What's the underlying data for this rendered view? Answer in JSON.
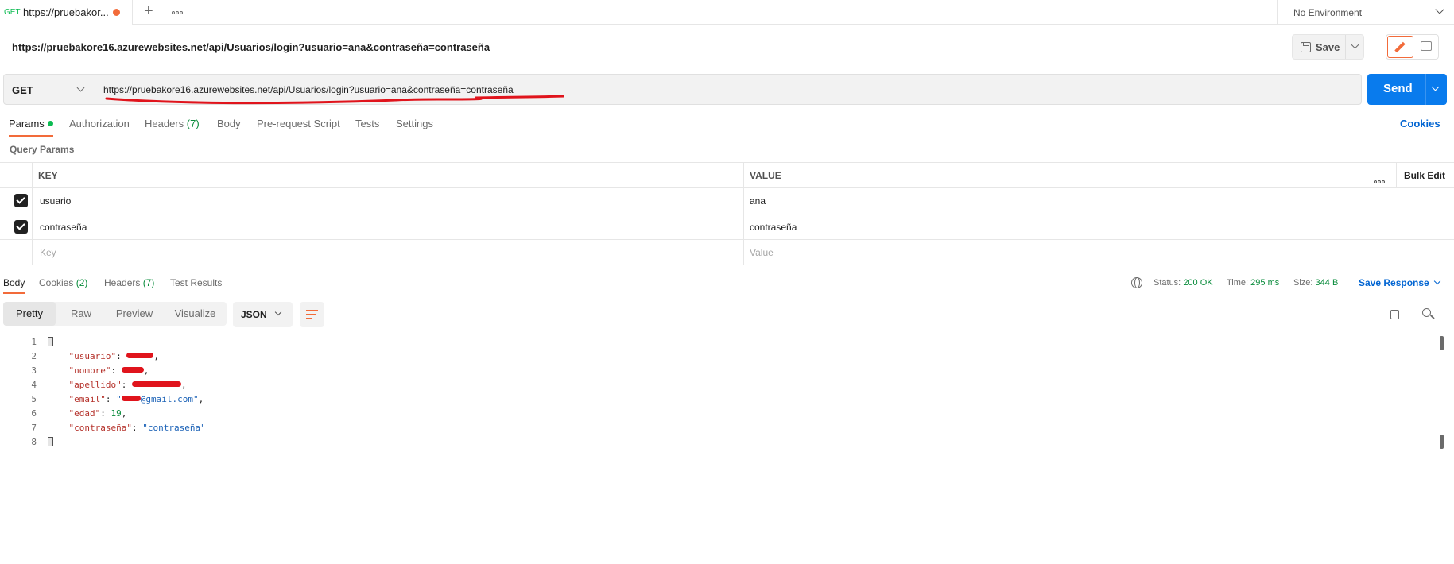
{
  "tabstrip": {
    "tab": {
      "method": "GET",
      "title": "https://pruebakor..."
    },
    "environment": "No Environment"
  },
  "request": {
    "name": "https://pruebakore16.azurewebsites.net/api/Usuarios/login?usuario=ana&contraseña=contraseña",
    "save_label": "Save",
    "method": "GET",
    "url": "https://pruebakore16.azurewebsites.net/api/Usuarios/login?usuario=ana&contraseña=contraseña",
    "send_label": "Send"
  },
  "request_tabs": {
    "params": "Params",
    "authorization": "Authorization",
    "headers": "Headers",
    "headers_count": "(7)",
    "body": "Body",
    "prerequest": "Pre-request Script",
    "tests": "Tests",
    "settings": "Settings",
    "cookies": "Cookies"
  },
  "query_params": {
    "title": "Query Params",
    "col_key": "KEY",
    "col_value": "VALUE",
    "bulk_edit": "Bulk Edit",
    "rows": [
      {
        "key": "usuario",
        "value": "ana",
        "checked": true
      },
      {
        "key": "contraseña",
        "value": "contraseña",
        "checked": true
      }
    ],
    "placeholder_key": "Key",
    "placeholder_value": "Value"
  },
  "response": {
    "tabs": {
      "body": "Body",
      "cookies": "Cookies",
      "cookies_count": "(2)",
      "headers": "Headers",
      "headers_count": "(7)",
      "test_results": "Test Results"
    },
    "status_label": "Status:",
    "status_value": "200 OK",
    "time_label": "Time:",
    "time_value": "295 ms",
    "size_label": "Size:",
    "size_value": "344 B",
    "save_response": "Save Response",
    "views": [
      "Pretty",
      "Raw",
      "Preview",
      "Visualize"
    ],
    "format": "JSON",
    "line_numbers": [
      "1",
      "2",
      "3",
      "4",
      "5",
      "6",
      "7",
      "8"
    ],
    "body_keys": {
      "usuario": "\"usuario\"",
      "nombre": "\"nombre\"",
      "apellido": "\"apellido\"",
      "email": "\"email\"",
      "email_suffix": "@gmail.com\"",
      "edad": "\"edad\"",
      "edad_value": "19",
      "contrasena": "\"contraseña\"",
      "contrasena_value": "\"contraseña\""
    }
  },
  "colors": {
    "accent": "#f26b3a",
    "send": "#097bed",
    "status_ok": "#0a8c3c",
    "link": "#0265d2",
    "annotation": "#e0141c"
  }
}
